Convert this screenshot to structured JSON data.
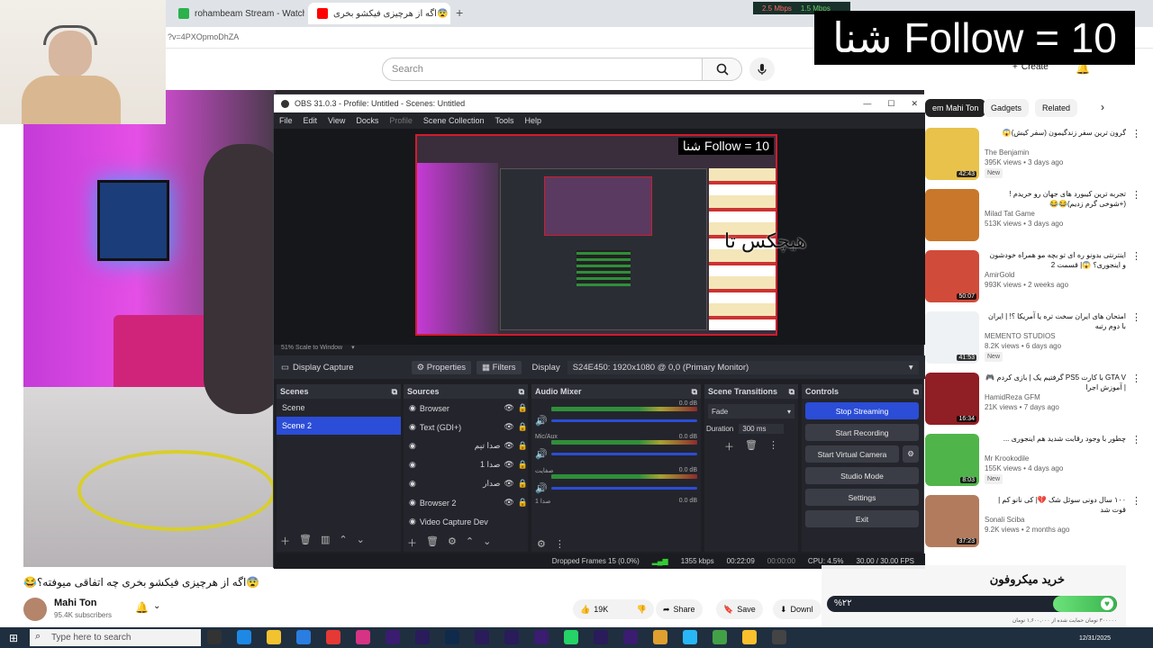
{
  "browser": {
    "tabs": [
      {
        "label": "rohambeam Stream - Watch Li"
      },
      {
        "label": "😨اگه از هرچیزی فیکشو بخری"
      }
    ],
    "new_tab": "+",
    "network": {
      "down": "2.5 Mbps",
      "up": "1.5 Mbps"
    },
    "address": "?v=4PXOpmoDhZA"
  },
  "youtube": {
    "search_placeholder": "Search",
    "create_label": "Create",
    "chips": [
      "em Mahi Ton",
      "Gadgets",
      "Related"
    ],
    "video_title": "😨اگه از هرچیزی فیکشو بخری چه اتفاقی میوفته؟😂",
    "channel_name": "Mahi Ton",
    "subscribers": "95.4K subscribers",
    "likes": "19K",
    "share_label": "Share",
    "save_label": "Save",
    "download_label": "Downl",
    "recommendations": [
      {
        "title": "گرون ترین سفر زندگیمون (سفر کیش)😱",
        "channel": "The Benjamin",
        "stats": "395K views • 3 days ago",
        "badge": "New",
        "duration": "42:43",
        "color": "#e8c24a"
      },
      {
        "title": "تجربه ترین کیبورد های جهان رو خریدم ! (+شوخی گرم زدیم)😂😂",
        "channel": "Milad Tat Game",
        "stats": "513K views • 3 days ago",
        "badge": "",
        "duration": "",
        "color": "#c9772a"
      },
      {
        "title": "اینترنتی بدونو ره ای تو بچه مو همراه خودشون و اینجوری؟ 😱| قسمت 2",
        "channel": "AmirGold",
        "stats": "993K views • 2 weeks ago",
        "badge": "",
        "duration": "50:07",
        "color": "#d14b3a"
      },
      {
        "title": "امتحان های ایران سخت تره یا آمریکا ؟! | ایران با دوم رتبه",
        "channel": "MEMENTO STUDIOS",
        "stats": "8.2K views • 6 days ago",
        "badge": "New",
        "duration": "41:53",
        "color": "#eef2f5"
      },
      {
        "title": "GTA V با کارت PS5 گرفتیم یک | بازی کردم 🎮 | آموزش اجرا",
        "channel": "HamidReza GFM",
        "stats": "21K views • 7 days ago",
        "badge": "",
        "duration": "16:34",
        "color": "#8f1f24"
      },
      {
        "title": "چطور با وجود رقابت شدید هم اینجوری ...",
        "channel": "Mr Krookodile",
        "stats": "155K views • 4 days ago",
        "badge": "New",
        "duration": "8:03",
        "color": "#4fb54a"
      },
      {
        "title": "۱۰۰ سال دونی سوئل شک 💔| کی نانو کم | قوت شد",
        "channel": "Sonali Sciba",
        "stats": "9.2K views • 2 months ago",
        "badge": "",
        "duration": "37:23",
        "color": "#b27b5d"
      }
    ]
  },
  "banner": {
    "text": "شنا Follow = 10"
  },
  "obs": {
    "title": "OBS 31.0.3 - Profile: Untitled - Scenes: Untitled",
    "menu": [
      "File",
      "Edit",
      "View",
      "Docks",
      "Profile",
      "Scene Collection",
      "Tools",
      "Help"
    ],
    "preview_follow": "شنا Follow = 10",
    "preview_caption": "هیچکس تا",
    "scale_label": "51%  Scale to Window",
    "source_name": "Display Capture",
    "properties_label": "Properties",
    "filters_label": "Filters",
    "display_label": "Display",
    "display_value": "S24E450: 1920x1080 @ 0,0 (Primary Monitor)",
    "docks": {
      "scenes": "Scenes",
      "sources": "Sources",
      "mixer": "Audio Mixer",
      "transitions": "Scene Transitions",
      "controls": "Controls"
    },
    "scenes": [
      "Scene",
      "Scene 2"
    ],
    "sources": [
      "Browser",
      "Text (GDI+)",
      "صدا تیم",
      "صدا 1",
      "صدار",
      "Browser 2",
      "Video Capture Dev"
    ],
    "mixer": [
      {
        "name": "",
        "db": "0.0 dB"
      },
      {
        "name": "Mic/Aux",
        "db": "0.0 dB"
      },
      {
        "name": "صفایت",
        "db": "0.0 dB"
      },
      {
        "name": "صدا 1",
        "db": "0.0 dB"
      }
    ],
    "transition": "Fade",
    "duration_label": "Duration",
    "duration_value": "300 ms",
    "controls": [
      "Stop Streaming",
      "Start Recording",
      "Start Virtual Camera",
      "Studio Mode",
      "Settings",
      "Exit"
    ],
    "status": {
      "dropped": "Dropped Frames 15 (0.0%)",
      "bitrate": "1355 kbps",
      "live_time": "00:22:09",
      "rec_time": "00:00:00",
      "cpu": "CPU: 4.5%",
      "fps": "30.00 / 30.00 FPS"
    }
  },
  "donation": {
    "title": "خرید میکروفون",
    "percent": "%۲۲",
    "progress": 0.22,
    "footnote": "۳۰۰۰۰۰ تومان حمایت شده از ۱,۶۰۰,۰۰۰ تومان"
  },
  "taskbar": {
    "search_placeholder": "Type here to search",
    "clock_date": "12/31/2025"
  }
}
